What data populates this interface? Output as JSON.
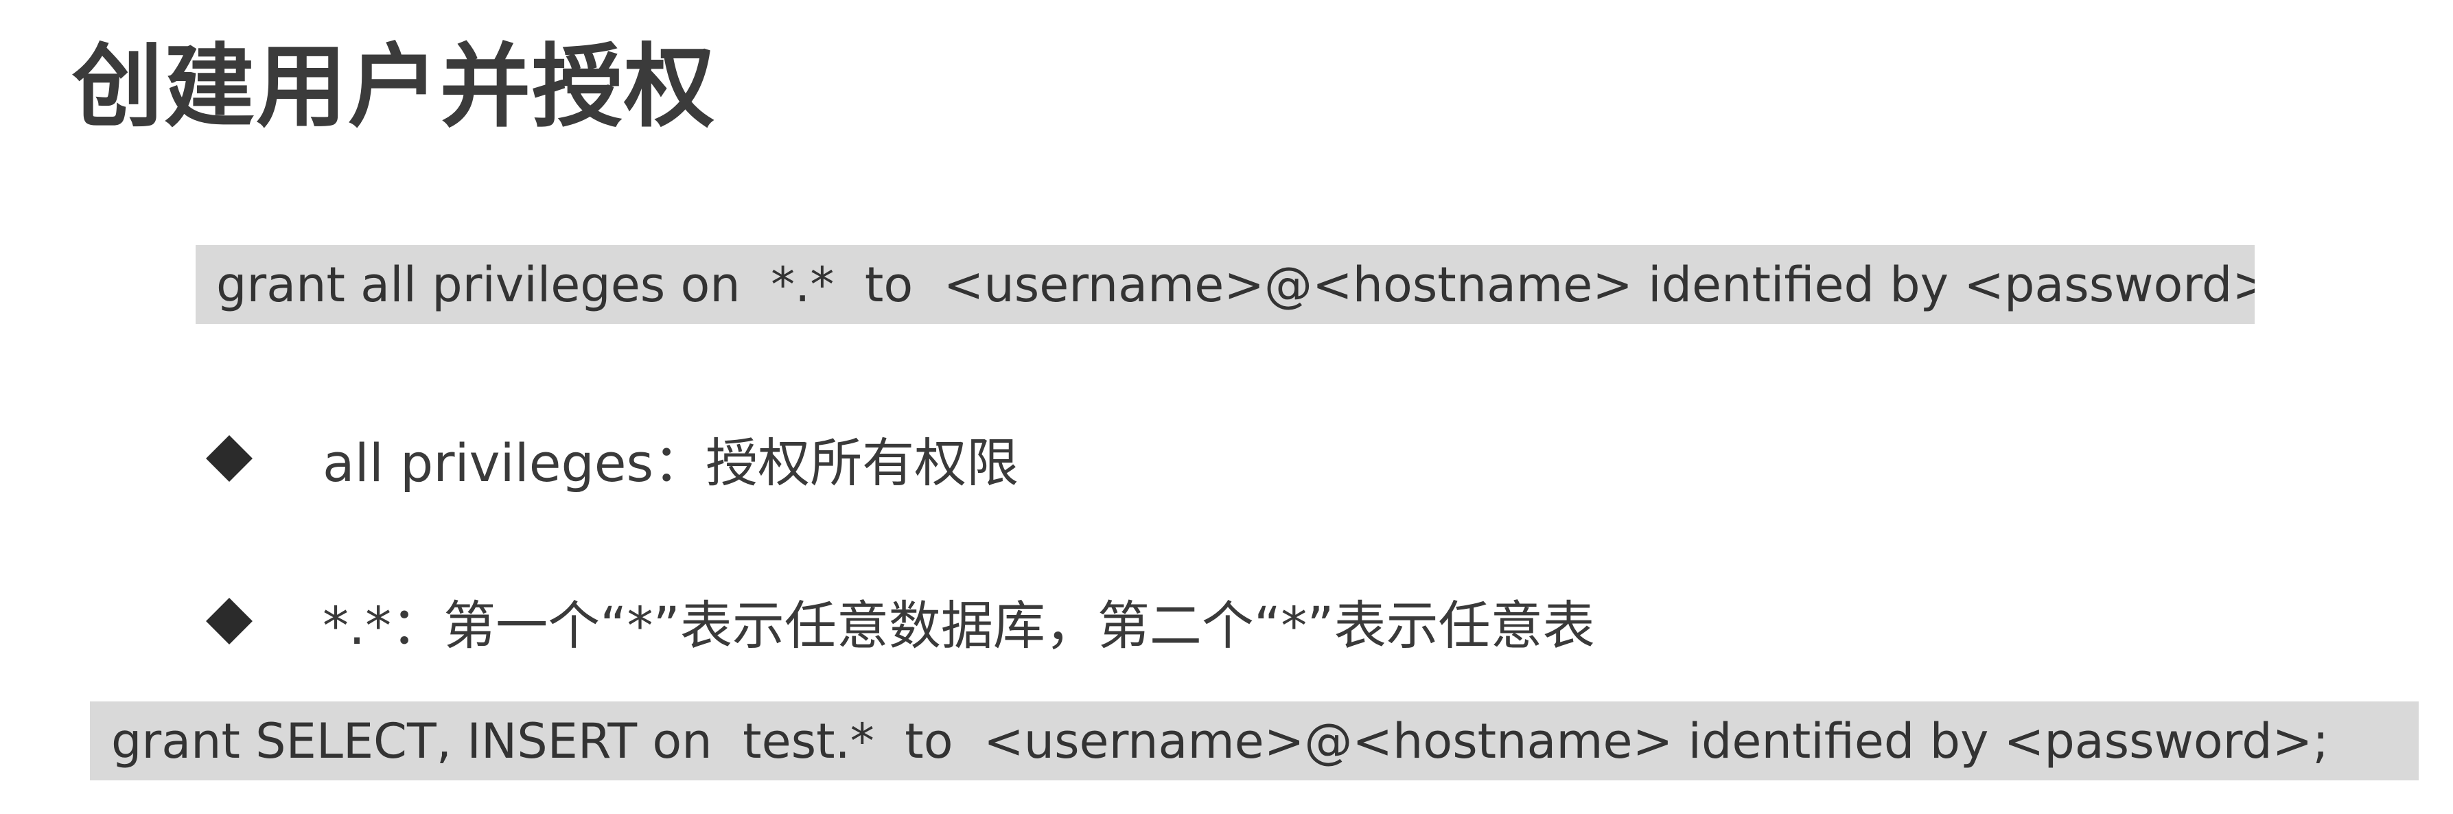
{
  "title": "创建用户并授权",
  "code_lines": [
    "grant all privileges on  *.*  to  <username>@<hostname> identified by <password>;",
    "grant SELECT, INSERT on  test.*  to  <username>@<hostname> identified by <password>;"
  ],
  "bullets": [
    {
      "icon": "diamond-bullet-icon",
      "text": "all privileges：授权所有权限"
    },
    {
      "icon": "diamond-bullet-icon",
      "text": "*.*：第一个“*”表示任意数据库，第二个“*”表示任意表"
    }
  ],
  "colors": {
    "code_background": "#d9d9d9",
    "text": "#3a3a3a",
    "bullet": "#2b2b2b"
  }
}
